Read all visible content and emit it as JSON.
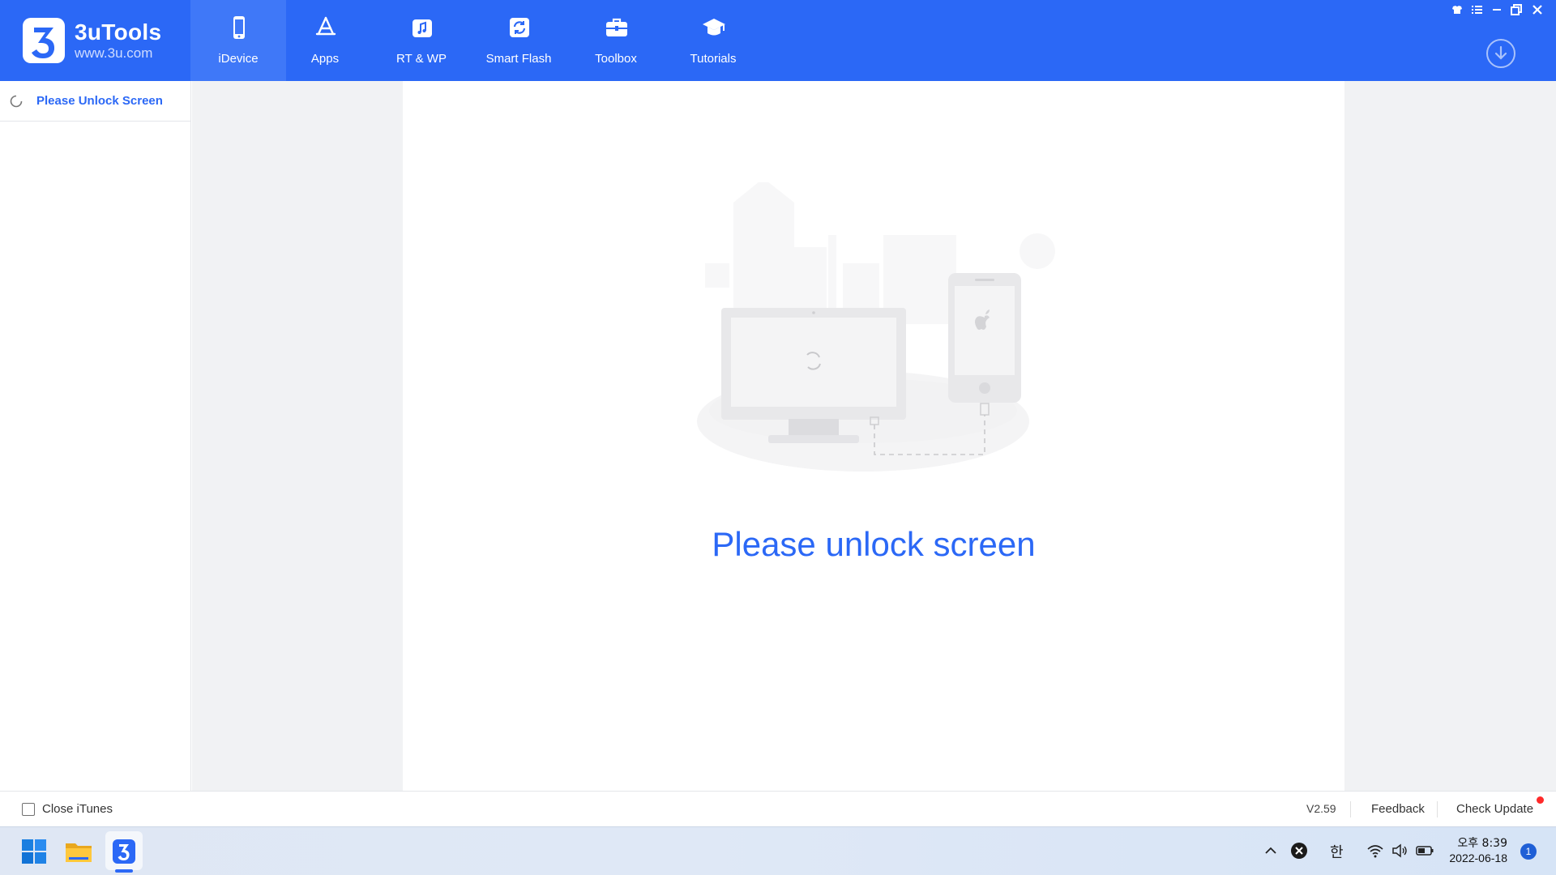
{
  "app": {
    "name": "3uTools",
    "url": "www.3u.com"
  },
  "nav": {
    "items": [
      {
        "label": "iDevice",
        "icon": "phone-icon",
        "active": true
      },
      {
        "label": "Apps",
        "icon": "app-store-icon",
        "active": false
      },
      {
        "label": "RT & WP",
        "icon": "music-file-icon",
        "active": false
      },
      {
        "label": "Smart Flash",
        "icon": "refresh-icon",
        "active": false
      },
      {
        "label": "Toolbox",
        "icon": "toolbox-icon",
        "active": false
      },
      {
        "label": "Tutorials",
        "icon": "graduation-cap-icon",
        "active": false
      }
    ]
  },
  "window_controls": [
    "skin-icon",
    "menu-list-icon",
    "minimize-icon",
    "restore-icon",
    "close-icon"
  ],
  "sidebar": {
    "device_status": "Please Unlock Screen"
  },
  "main": {
    "message": "Please unlock screen"
  },
  "statusbar": {
    "close_itunes_label": "Close iTunes",
    "close_itunes_checked": false,
    "version": "V2.59",
    "feedback": "Feedback",
    "check_update": "Check Update"
  },
  "taskbar": {
    "apps": [
      "windows-start-icon",
      "file-explorer-icon",
      "3utools-icon"
    ],
    "ime": "한",
    "clock_time": "오후 8:39",
    "clock_date": "2022-06-18",
    "notifications": "1"
  },
  "colors": {
    "accent": "#2b68f6",
    "nav_active": "#3f78f8",
    "main_bg": "#f1f2f4",
    "update_dot": "#ff2a2a"
  }
}
